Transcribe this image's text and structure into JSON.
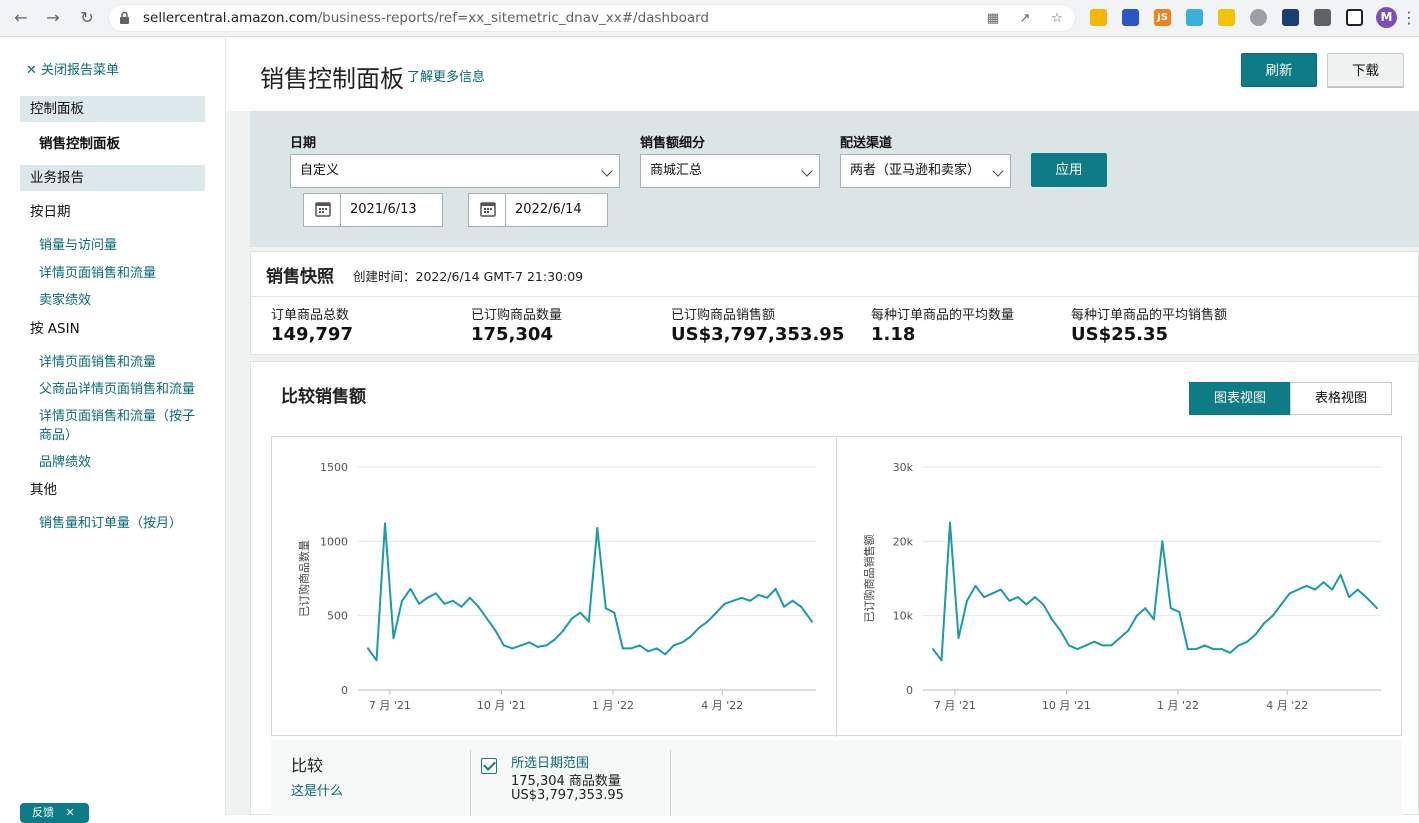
{
  "browser": {
    "url_main": "sellercentral.amazon.com",
    "url_path": "/business-reports/ref=xx_sitemetric_dnav_xx#/dashboard",
    "profile_initial": "M"
  },
  "sidebar": {
    "close_label": "关闭报告菜单",
    "section1": "控制面板",
    "active_item": "销售控制面板",
    "section2": "业务报告",
    "group_by_date": "按日期",
    "by_date_items": [
      "销量与访问量",
      "详情页面销售和流量",
      "卖家绩效"
    ],
    "group_by_asin": "按 ASIN",
    "by_asin_items": [
      "详情页面销售和流量",
      "父商品详情页面销售和流量",
      "详情页面销售和流量（按子",
      "商品）",
      "品牌绩效"
    ],
    "group_other": "其他",
    "other_items": [
      "销售量和订单量（按月）"
    ],
    "feedback": "反馈"
  },
  "header": {
    "title": "销售控制面板",
    "learn_more": "了解更多信息",
    "refresh": "刷新",
    "download": "下载"
  },
  "filters": {
    "date_label": "日期",
    "date_value": "自定义",
    "sales_breakdown_label": "销售额细分",
    "sales_breakdown_value": "商城汇总",
    "channel_label": "配送渠道",
    "channel_value": "两者（亚马逊和卖家）",
    "start_date": "2021/6/13",
    "end_date": "2022/6/14",
    "apply": "应用"
  },
  "snapshot": {
    "title": "销售快照",
    "created": "创建时间：2022/6/14 GMT-7 21:30:09",
    "metrics": [
      {
        "label": "订单商品总数",
        "value": "149,797"
      },
      {
        "label": "已订购商品数量",
        "value": "175,304"
      },
      {
        "label": "已订购商品销售额",
        "value": "US$3,797,353.95"
      },
      {
        "label": "每种订单商品的平均数量",
        "value": "1.18"
      },
      {
        "label": "每种订单商品的平均销售额",
        "value": "US$25.35"
      }
    ]
  },
  "compare": {
    "title": "比较销售额",
    "chart_view": "图表视图",
    "table_view": "表格视图",
    "compare_label": "比较",
    "what_is_this": "这是什么",
    "range_label": "所选日期范围",
    "range_units": "175,304 商品数量",
    "range_sales": "US$3,797,353.95"
  },
  "colors": {
    "accent": "#0e7c86",
    "line": "#1a9ba6",
    "link": "#0b6b78"
  },
  "chart_data": [
    {
      "type": "line",
      "ylabel": "已订购商品数量",
      "ylim": [
        0,
        1500
      ],
      "yticks": [
        "0",
        "500",
        "1000",
        "1500"
      ],
      "xticks": [
        "7 月 '21",
        "10 月 '21",
        "1 月 '22",
        "4 月 '22"
      ],
      "x": [
        "2021-06-13",
        "2021-06-20",
        "2021-06-27",
        "2021-07-04",
        "2021-07-11",
        "2021-07-18",
        "2021-07-25",
        "2021-08-01",
        "2021-08-08",
        "2021-08-15",
        "2021-08-22",
        "2021-08-29",
        "2021-09-05",
        "2021-09-12",
        "2021-09-19",
        "2021-09-26",
        "2021-10-03",
        "2021-10-10",
        "2021-10-17",
        "2021-10-24",
        "2021-10-31",
        "2021-11-07",
        "2021-11-14",
        "2021-11-21",
        "2021-11-28",
        "2021-12-05",
        "2021-12-12",
        "2021-12-19",
        "2021-12-26",
        "2022-01-02",
        "2022-01-09",
        "2022-01-16",
        "2022-01-23",
        "2022-01-30",
        "2022-02-06",
        "2022-02-13",
        "2022-02-20",
        "2022-02-27",
        "2022-03-06",
        "2022-03-13",
        "2022-03-20",
        "2022-03-27",
        "2022-04-03",
        "2022-04-10",
        "2022-04-17",
        "2022-04-24",
        "2022-05-01",
        "2022-05-08",
        "2022-05-15",
        "2022-05-22",
        "2022-05-29",
        "2022-06-05",
        "2022-06-14"
      ],
      "series": [
        {
          "values": [
            280,
            200,
            1120,
            350,
            600,
            680,
            580,
            620,
            650,
            580,
            600,
            560,
            620,
            560,
            480,
            400,
            300,
            280,
            300,
            320,
            290,
            300,
            340,
            400,
            480,
            520,
            460,
            1090,
            550,
            520,
            280,
            280,
            300,
            260,
            280,
            240,
            300,
            320,
            360,
            420,
            460,
            520,
            580,
            600,
            620,
            600,
            640,
            620,
            680,
            560,
            600,
            560,
            460
          ]
        }
      ]
    },
    {
      "type": "line",
      "ylabel": "已订购商品销售额",
      "ylim": [
        0,
        30000
      ],
      "yticks": [
        "0",
        "10k",
        "20k",
        "30k"
      ],
      "xticks": [
        "7 月 '21",
        "10 月 '21",
        "1 月 '22",
        "4 月 '22"
      ],
      "x": [
        "2021-06-13",
        "2021-06-20",
        "2021-06-27",
        "2021-07-04",
        "2021-07-11",
        "2021-07-18",
        "2021-07-25",
        "2021-08-01",
        "2021-08-08",
        "2021-08-15",
        "2021-08-22",
        "2021-08-29",
        "2021-09-05",
        "2021-09-12",
        "2021-09-19",
        "2021-09-26",
        "2021-10-03",
        "2021-10-10",
        "2021-10-17",
        "2021-10-24",
        "2021-10-31",
        "2021-11-07",
        "2021-11-14",
        "2021-11-21",
        "2021-11-28",
        "2021-12-05",
        "2021-12-12",
        "2021-12-19",
        "2021-12-26",
        "2022-01-02",
        "2022-01-09",
        "2022-01-16",
        "2022-01-23",
        "2022-01-30",
        "2022-02-06",
        "2022-02-13",
        "2022-02-20",
        "2022-02-27",
        "2022-03-06",
        "2022-03-13",
        "2022-03-20",
        "2022-03-27",
        "2022-04-03",
        "2022-04-10",
        "2022-04-17",
        "2022-04-24",
        "2022-05-01",
        "2022-05-08",
        "2022-05-15",
        "2022-05-22",
        "2022-05-29",
        "2022-06-05",
        "2022-06-14"
      ],
      "series": [
        {
          "values": [
            5500,
            4000,
            22500,
            7000,
            12000,
            14000,
            12500,
            13000,
            13500,
            12000,
            12500,
            11500,
            12500,
            11500,
            9500,
            8000,
            6000,
            5500,
            6000,
            6500,
            6000,
            6000,
            7000,
            8000,
            10000,
            11000,
            9500,
            20000,
            11000,
            10500,
            5500,
            5500,
            6000,
            5500,
            5500,
            5000,
            6000,
            6500,
            7500,
            9000,
            10000,
            11500,
            13000,
            13500,
            14000,
            13500,
            14500,
            13500,
            15500,
            12500,
            13500,
            12500,
            11000
          ]
        }
      ]
    }
  ]
}
